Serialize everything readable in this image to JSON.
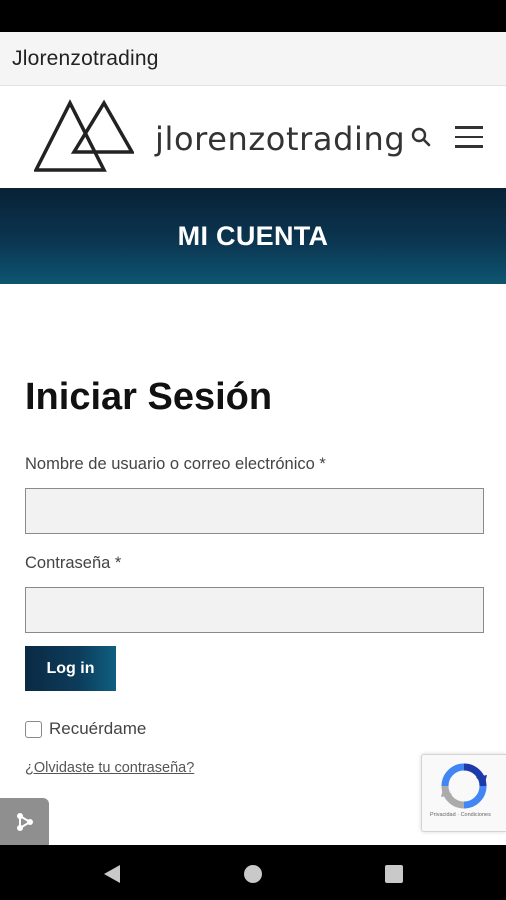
{
  "browser": {
    "title": "Jlorenzotrading"
  },
  "header": {
    "brand": "jlorenzotrading",
    "search_icon": "search-icon",
    "menu_icon": "hamburger-menu-icon"
  },
  "banner": {
    "title": "MI CUENTA"
  },
  "login": {
    "heading": "Iniciar Sesión",
    "username_label": "Nombre de usuario o correo electrónico *",
    "username_value": "",
    "password_label": "Contraseña *",
    "password_value": "",
    "submit_label": "Log in",
    "remember_label": "Recuérdame",
    "remember_checked": false,
    "forgot_link": "¿Olvidaste tu contraseña?"
  },
  "recaptcha": {
    "text": "Privacidad · Condiciones"
  },
  "colors": {
    "banner_dark": "#082236",
    "banner_light": "#0d5571",
    "button": "#0c3d5c"
  }
}
